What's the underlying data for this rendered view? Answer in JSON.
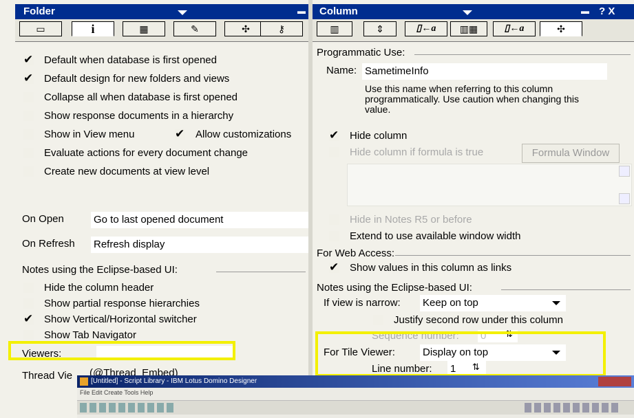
{
  "left_panel": {
    "title": "Folder",
    "checkboxes": [
      {
        "label": "Default when database is first opened",
        "checked": true
      },
      {
        "label": "Default design for new folders and views",
        "checked": true
      },
      {
        "label": "Collapse all when database is first opened",
        "checked": false
      },
      {
        "label": "Show response documents in a hierarchy",
        "checked": false
      },
      {
        "label": "Show in View menu",
        "checked": false
      },
      {
        "label": "Allow customizations",
        "checked": true
      },
      {
        "label": "Evaluate actions for every document change",
        "checked": false
      },
      {
        "label": "Create new documents at view level",
        "checked": false
      }
    ],
    "on_open_label": "On Open",
    "on_open_value": "Go to last opened document",
    "on_refresh_label": "On Refresh",
    "on_refresh_value": "Refresh display",
    "eclipse_section": "Notes using the Eclipse-based UI:",
    "eclipse_checkboxes": [
      {
        "label": "Hide the column header",
        "checked": false
      },
      {
        "label": "Show partial response hierarchies",
        "checked": false
      },
      {
        "label": "Show Vertical/Horizontal switcher",
        "checked": true
      },
      {
        "label": "Show Tab Navigator",
        "checked": false
      }
    ],
    "viewers_label": "Viewers:",
    "viewers_value": "",
    "thread_view_label": "Thread Vie",
    "thread_view_value": "(@Thread_Embed)"
  },
  "right_panel": {
    "title": "Column",
    "title_buttons": "? X",
    "prog_use_section": "Programmatic Use:",
    "name_label": "Name:",
    "name_value": "SametimeInfo",
    "name_help": "Use this name when referring to this column programmatically.  Use caution when changing this value.",
    "hide_column": {
      "label": "Hide column",
      "checked": true
    },
    "hide_formula": {
      "label": "Hide column if formula is true",
      "checked": false
    },
    "formula_button": "Formula Window",
    "hide_r5": {
      "label": "Hide in Notes R5 or before",
      "checked": false
    },
    "extend": {
      "label": "Extend to use available window width",
      "checked": false
    },
    "web_section": "For Web Access:",
    "show_links": {
      "label": "Show values in this column as links",
      "checked": true
    },
    "eclipse_section": "Notes using the  Eclipse-based UI:",
    "narrow_label": "If view is narrow:",
    "narrow_value": "Keep on top",
    "justify": {
      "label": "Justify second row under this column",
      "checked": false
    },
    "sequence_label": "Sequence number:",
    "sequence_value": "0",
    "tile_label": "For Tile Viewer:",
    "tile_value": "Display on top",
    "line_label": "Line number:",
    "line_value": "1"
  },
  "taskbar": {
    "title": "[Untitled] - Script Library - IBM Lotus Domino Designer",
    "menu": "File  Edit  Create  Tools  Help"
  },
  "colors": {
    "title_bar": "#002d8f",
    "highlight": "#f3f000",
    "background": "#f2f1ea"
  }
}
